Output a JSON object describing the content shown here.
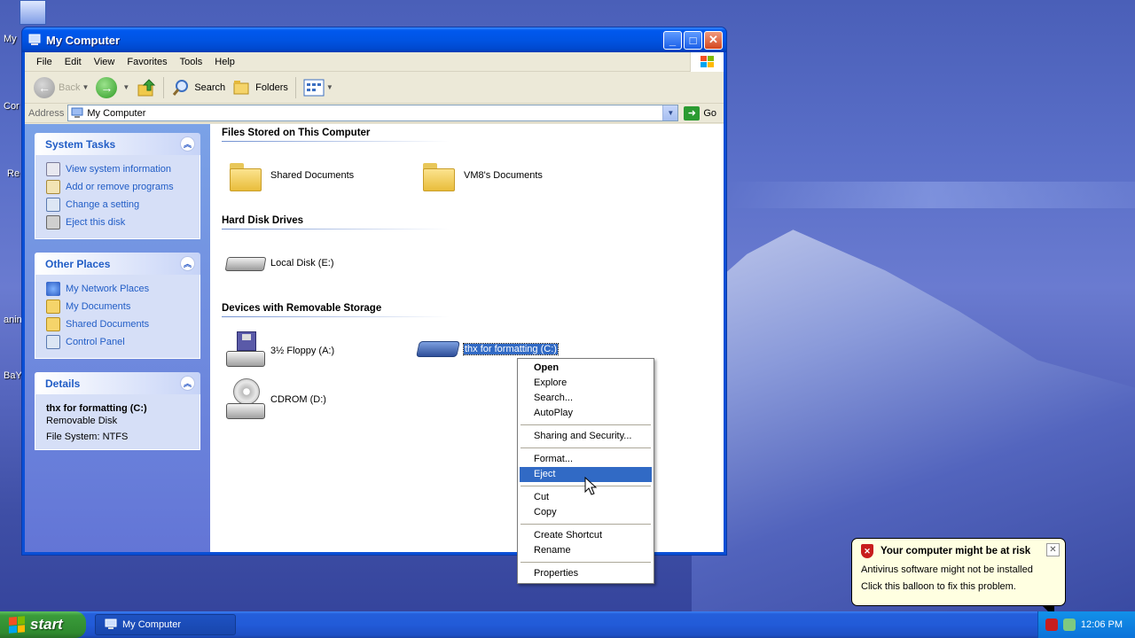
{
  "desktop": {
    "icon_labels": [
      "My",
      "Cor",
      "Re",
      "anin",
      "BaY"
    ]
  },
  "window": {
    "title": "My Computer",
    "menu": [
      "File",
      "Edit",
      "View",
      "Favorites",
      "Tools",
      "Help"
    ],
    "toolbar": {
      "back": "Back",
      "search": "Search",
      "folders": "Folders"
    },
    "address": {
      "label": "Address",
      "value": "My Computer",
      "go": "Go"
    }
  },
  "taskpane": {
    "system_tasks": {
      "title": "System Tasks",
      "items": [
        "View system information",
        "Add or remove programs",
        "Change a setting",
        "Eject this disk"
      ]
    },
    "other_places": {
      "title": "Other Places",
      "items": [
        "My Network Places",
        "My Documents",
        "Shared Documents",
        "Control Panel"
      ]
    },
    "details": {
      "title": "Details",
      "name": "thx for formatting (C:)",
      "type": "Removable Disk",
      "fs": "File System: NTFS"
    }
  },
  "groups": {
    "files": {
      "title": "Files Stored on This Computer",
      "items": [
        "Shared Documents",
        "VM8's Documents"
      ]
    },
    "hdd": {
      "title": "Hard Disk Drives",
      "items": [
        "Local Disk (E:)"
      ]
    },
    "removable": {
      "title": "Devices with Removable Storage",
      "items": [
        "3½ Floppy (A:)",
        "thx for formatting (C:)",
        "CDROM (D:)"
      ]
    }
  },
  "context_menu": {
    "items": [
      "Open",
      "Explore",
      "Search...",
      "AutoPlay",
      "Sharing and Security...",
      "Format...",
      "Eject",
      "Cut",
      "Copy",
      "Create Shortcut",
      "Rename",
      "Properties"
    ],
    "highlighted": "Eject"
  },
  "balloon": {
    "title": "Your computer might be at risk",
    "line1": "Antivirus software might not be installed",
    "line2": "Click this balloon to fix this problem."
  },
  "taskbar": {
    "start": "start",
    "task": "My Computer",
    "clock": "12:06 PM"
  },
  "colors": {
    "selection": "#316ac5",
    "titlebar": "#0054e3",
    "link": "#215dc6"
  }
}
